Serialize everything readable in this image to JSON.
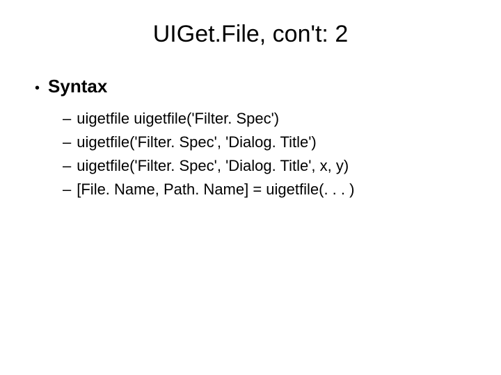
{
  "title": "UIGet.File, con't: 2",
  "section_heading": "Syntax",
  "items": [
    "uigetfile uigetfile('Filter. Spec')",
    "uigetfile('Filter. Spec', 'Dialog. Title')",
    "uigetfile('Filter. Spec', 'Dialog. Title', x, y)",
    "[File. Name, Path. Name] = uigetfile(. . . )"
  ]
}
